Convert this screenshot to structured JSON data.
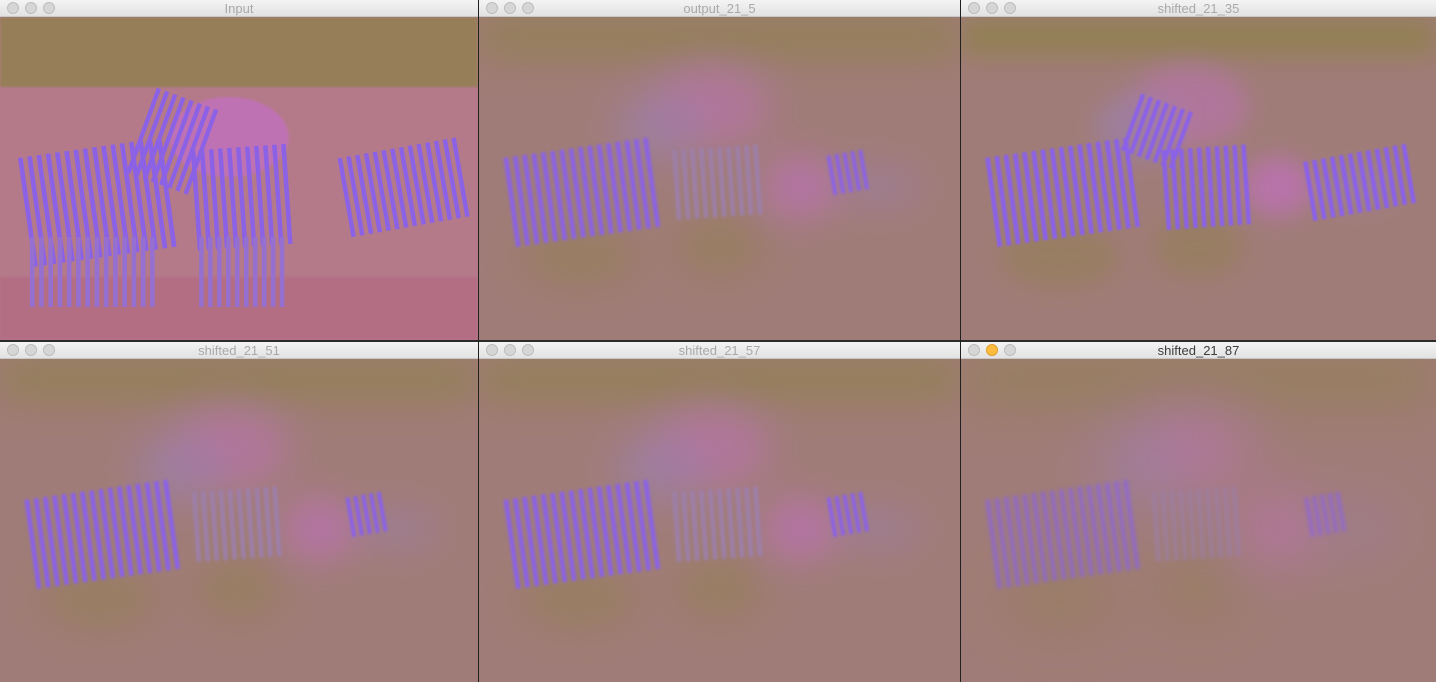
{
  "windows": [
    {
      "title": "Input",
      "focused": false,
      "view": "input",
      "blur": 0
    },
    {
      "title": "output_21_5",
      "focused": false,
      "view": "blurred",
      "blur": 1
    },
    {
      "title": "shifted_21_35",
      "focused": false,
      "view": "shifted",
      "blur": 0.6
    },
    {
      "title": "shifted_21_51",
      "focused": false,
      "view": "blurred",
      "blur": 1
    },
    {
      "title": "shifted_21_57",
      "focused": false,
      "view": "blurred",
      "blur": 1
    },
    {
      "title": "shifted_21_87",
      "focused": true,
      "view": "blurred",
      "blur": 1.5
    }
  ],
  "colors": {
    "background": "#a07c78",
    "olive": "#8f7f4c",
    "pink": "#c26fbd",
    "stripe": "#8b62e6",
    "mauve": "#9d7fa8"
  },
  "icons": {
    "close": "close-traffic-light-icon",
    "minimize": "minimize-traffic-light-icon",
    "maximize": "maximize-traffic-light-icon"
  }
}
